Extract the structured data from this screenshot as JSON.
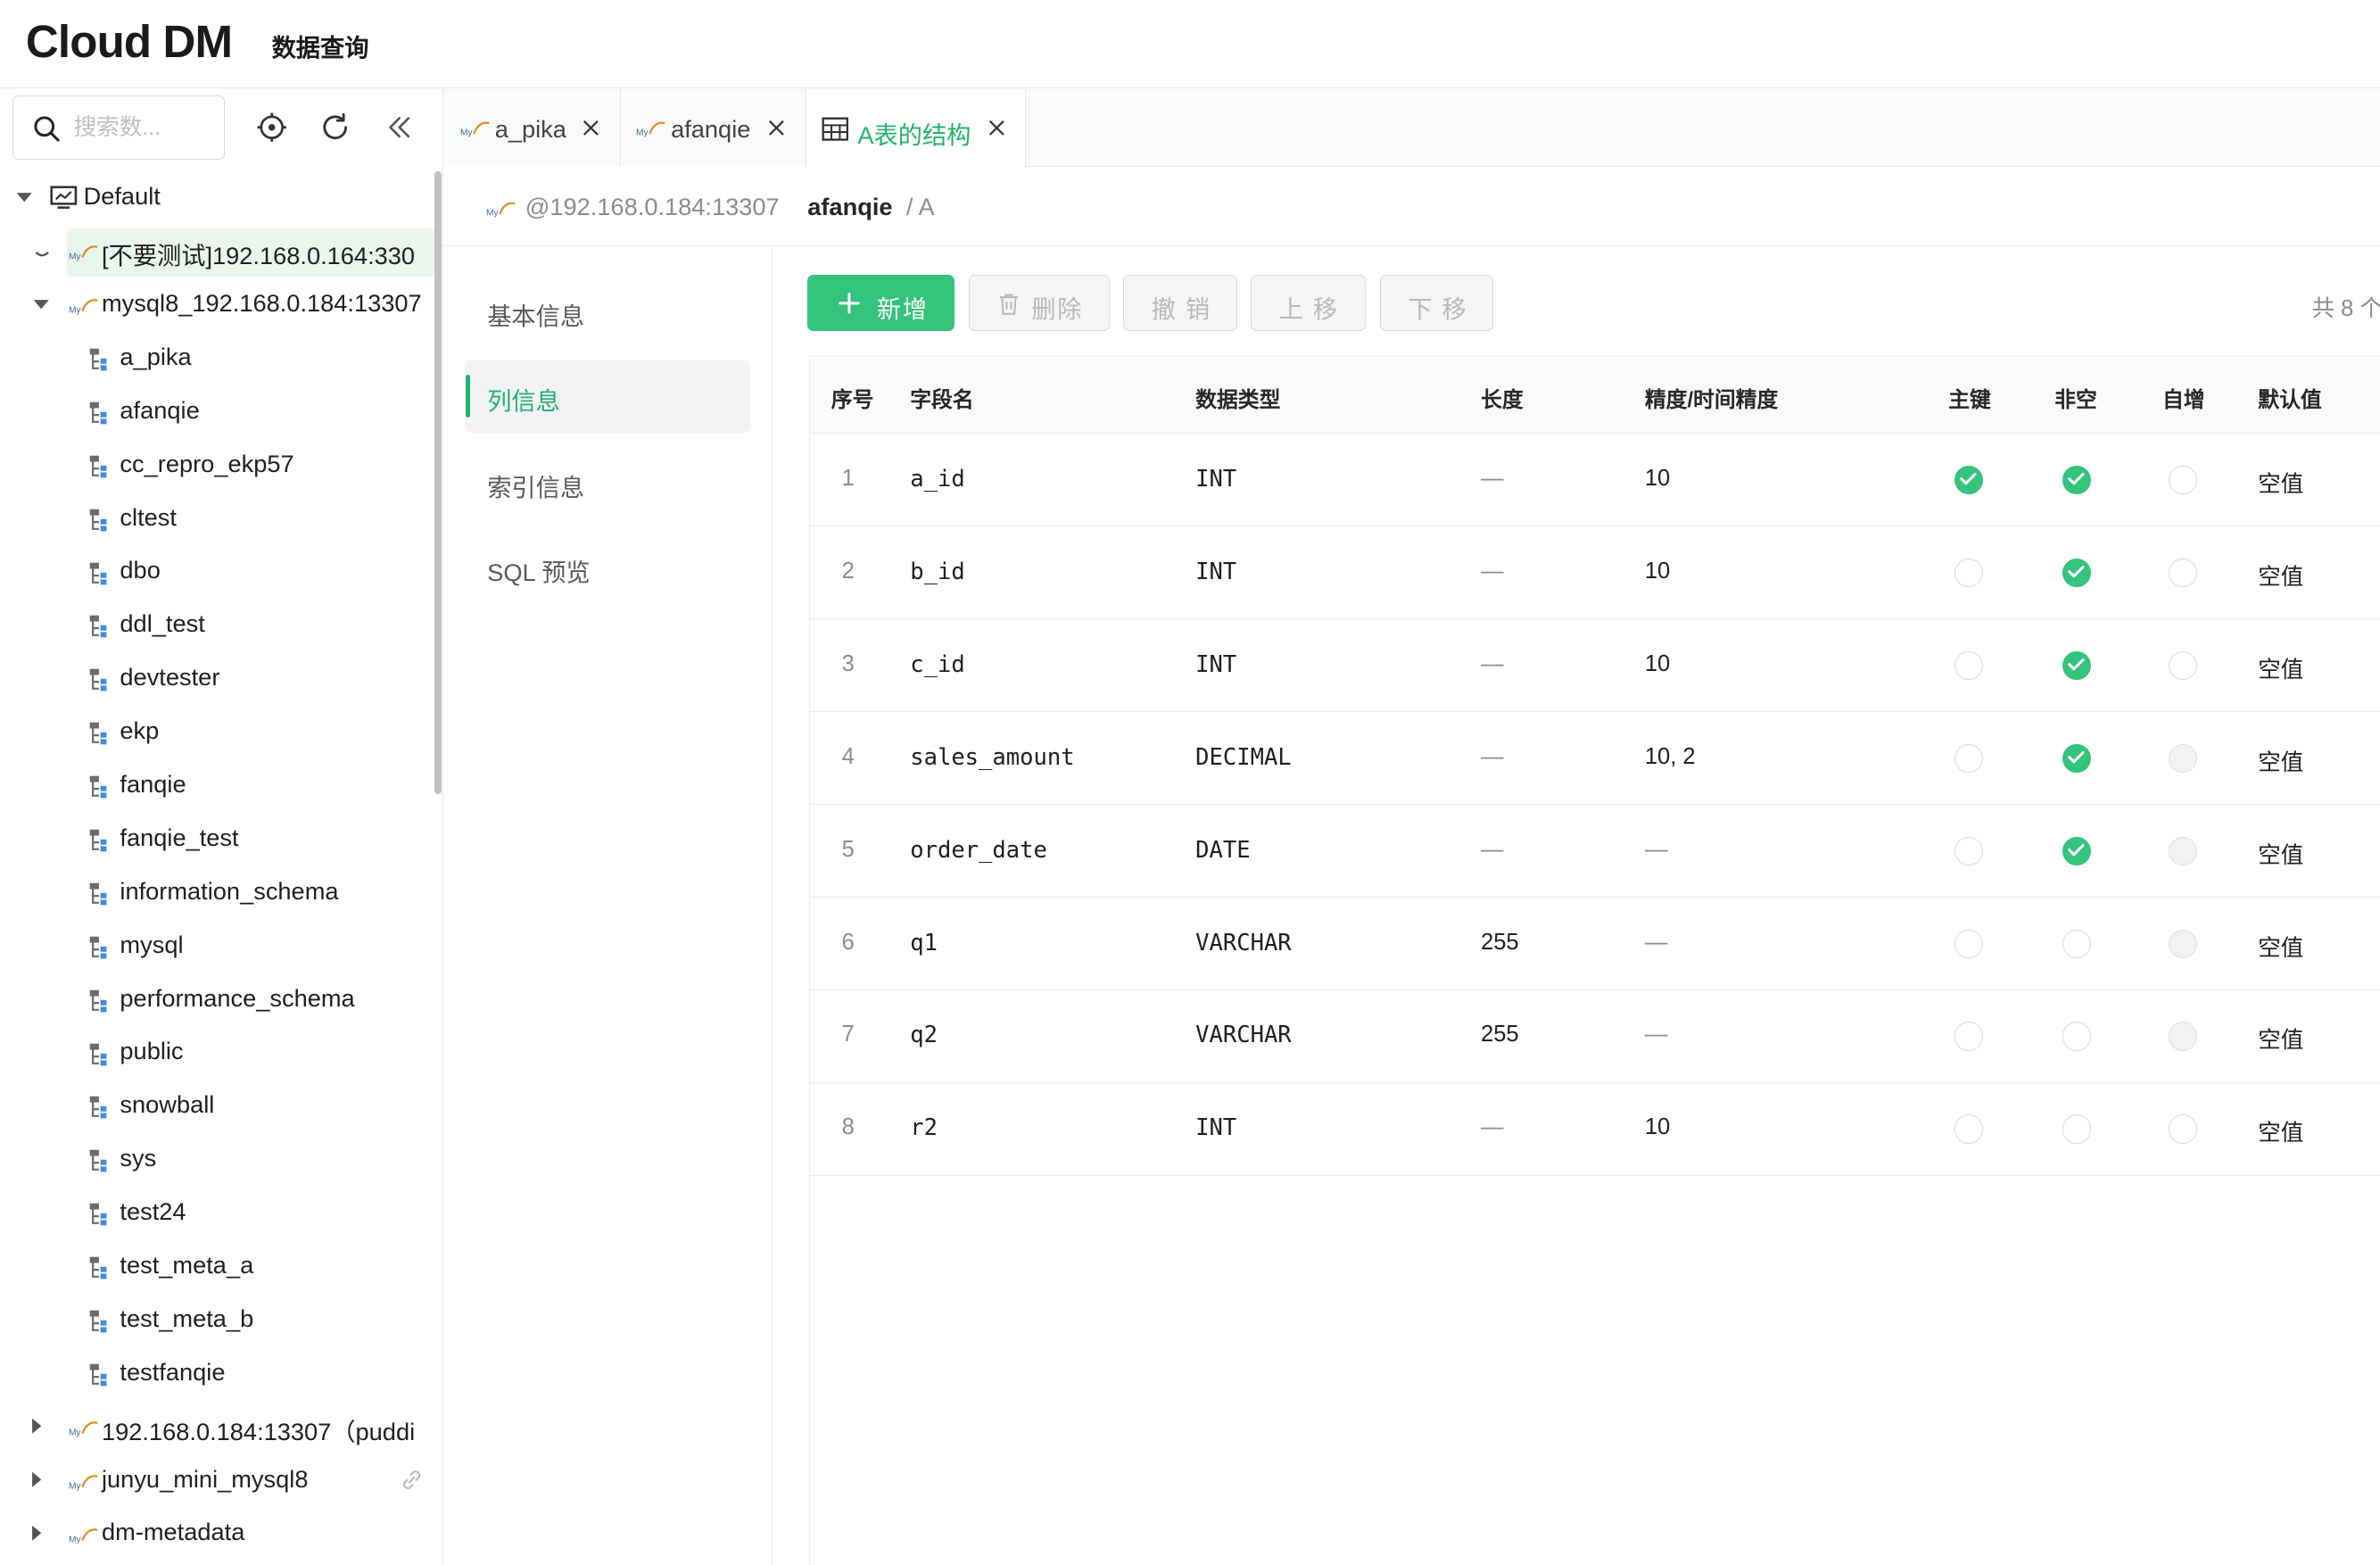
{
  "header": {
    "logo": "Cloud DM",
    "subtitle": "数据查询"
  },
  "sidebar": {
    "search_placeholder": "搜索数...",
    "tree": [
      {
        "label": "Default",
        "level": 0,
        "kind": "group",
        "expanded": true
      },
      {
        "label": "[不要测试]192.168.0.164:330",
        "level": 1,
        "kind": "conn",
        "expanded": false,
        "highlight": true
      },
      {
        "label": "mysql8_192.168.0.184:13307",
        "level": 1,
        "kind": "conn",
        "expanded": true
      },
      {
        "label": "a_pika",
        "level": 2,
        "kind": "schema"
      },
      {
        "label": "afanqie",
        "level": 2,
        "kind": "schema"
      },
      {
        "label": "cc_repro_ekp57",
        "level": 2,
        "kind": "schema"
      },
      {
        "label": "cltest",
        "level": 2,
        "kind": "schema"
      },
      {
        "label": "dbo",
        "level": 2,
        "kind": "schema"
      },
      {
        "label": "ddl_test",
        "level": 2,
        "kind": "schema"
      },
      {
        "label": "devtester",
        "level": 2,
        "kind": "schema"
      },
      {
        "label": "ekp",
        "level": 2,
        "kind": "schema"
      },
      {
        "label": "fanqie",
        "level": 2,
        "kind": "schema"
      },
      {
        "label": "fanqie_test",
        "level": 2,
        "kind": "schema"
      },
      {
        "label": "information_schema",
        "level": 2,
        "kind": "schema"
      },
      {
        "label": "mysql",
        "level": 2,
        "kind": "schema"
      },
      {
        "label": "performance_schema",
        "level": 2,
        "kind": "schema"
      },
      {
        "label": "public",
        "level": 2,
        "kind": "schema"
      },
      {
        "label": "snowball",
        "level": 2,
        "kind": "schema"
      },
      {
        "label": "sys",
        "level": 2,
        "kind": "schema"
      },
      {
        "label": "test24",
        "level": 2,
        "kind": "schema"
      },
      {
        "label": "test_meta_a",
        "level": 2,
        "kind": "schema"
      },
      {
        "label": "test_meta_b",
        "level": 2,
        "kind": "schema"
      },
      {
        "label": "testfanqie",
        "level": 2,
        "kind": "schema"
      },
      {
        "label": "192.168.0.184:13307（puddi",
        "level": 1,
        "kind": "conn",
        "expanded": false
      },
      {
        "label": "junyu_mini_mysql8",
        "level": 1,
        "kind": "conn",
        "expanded": false,
        "link": true
      },
      {
        "label": "dm-metadata",
        "level": 1,
        "kind": "conn",
        "expanded": false
      }
    ]
  },
  "tabs": [
    {
      "label": "a_pika",
      "icon": "mysql-icon",
      "active": false
    },
    {
      "label": "afanqie",
      "icon": "mysql-icon",
      "active": false
    },
    {
      "label": "A表的结构",
      "icon": "table-icon",
      "active": true
    }
  ],
  "breadcrumb": {
    "host": "@192.168.0.184:13307",
    "db": "afanqie",
    "table": "/ A"
  },
  "menu": [
    {
      "label": "基本信息",
      "active": false
    },
    {
      "label": "列信息",
      "active": true
    },
    {
      "label": "索引信息",
      "active": false
    },
    {
      "label": "SQL 预览",
      "active": false
    }
  ],
  "toolbar": {
    "add": "新增",
    "delete": "删除",
    "undo": "撤 销",
    "up": "上 移",
    "down": "下 移",
    "total": "共 8 个"
  },
  "table": {
    "headers": [
      "序号",
      "字段名",
      "数据类型",
      "长度",
      "精度/时间精度",
      "主键",
      "非空",
      "自增",
      "默认值"
    ],
    "rows": [
      {
        "idx": "1",
        "name": "a_id",
        "type": "INT",
        "length": "—",
        "precision": "10",
        "pk": "on",
        "notnull": "on",
        "ai": "off",
        "default": "空值"
      },
      {
        "idx": "2",
        "name": "b_id",
        "type": "INT",
        "length": "—",
        "precision": "10",
        "pk": "off",
        "notnull": "on",
        "ai": "off",
        "default": "空值"
      },
      {
        "idx": "3",
        "name": "c_id",
        "type": "INT",
        "length": "—",
        "precision": "10",
        "pk": "off",
        "notnull": "on",
        "ai": "off",
        "default": "空值"
      },
      {
        "idx": "4",
        "name": "sales_amount",
        "type": "DECIMAL",
        "length": "—",
        "precision": "10, 2",
        "pk": "off",
        "notnull": "on",
        "ai": "disabled",
        "default": "空值"
      },
      {
        "idx": "5",
        "name": "order_date",
        "type": "DATE",
        "length": "—",
        "precision": "—",
        "pk": "off",
        "notnull": "on",
        "ai": "disabled",
        "default": "空值"
      },
      {
        "idx": "6",
        "name": "q1",
        "type": "VARCHAR",
        "length": "255",
        "precision": "—",
        "pk": "off",
        "notnull": "off",
        "ai": "disabled",
        "default": "空值"
      },
      {
        "idx": "7",
        "name": "q2",
        "type": "VARCHAR",
        "length": "255",
        "precision": "—",
        "pk": "off",
        "notnull": "off",
        "ai": "disabled",
        "default": "空值"
      },
      {
        "idx": "8",
        "name": "r2",
        "type": "INT",
        "length": "—",
        "precision": "10",
        "pk": "off",
        "notnull": "off",
        "ai": "off",
        "default": "空值"
      }
    ]
  },
  "colors": {
    "accent": "#34c47c",
    "accent_text": "#21b26a",
    "highlight_bg": "#e9f6ee"
  }
}
